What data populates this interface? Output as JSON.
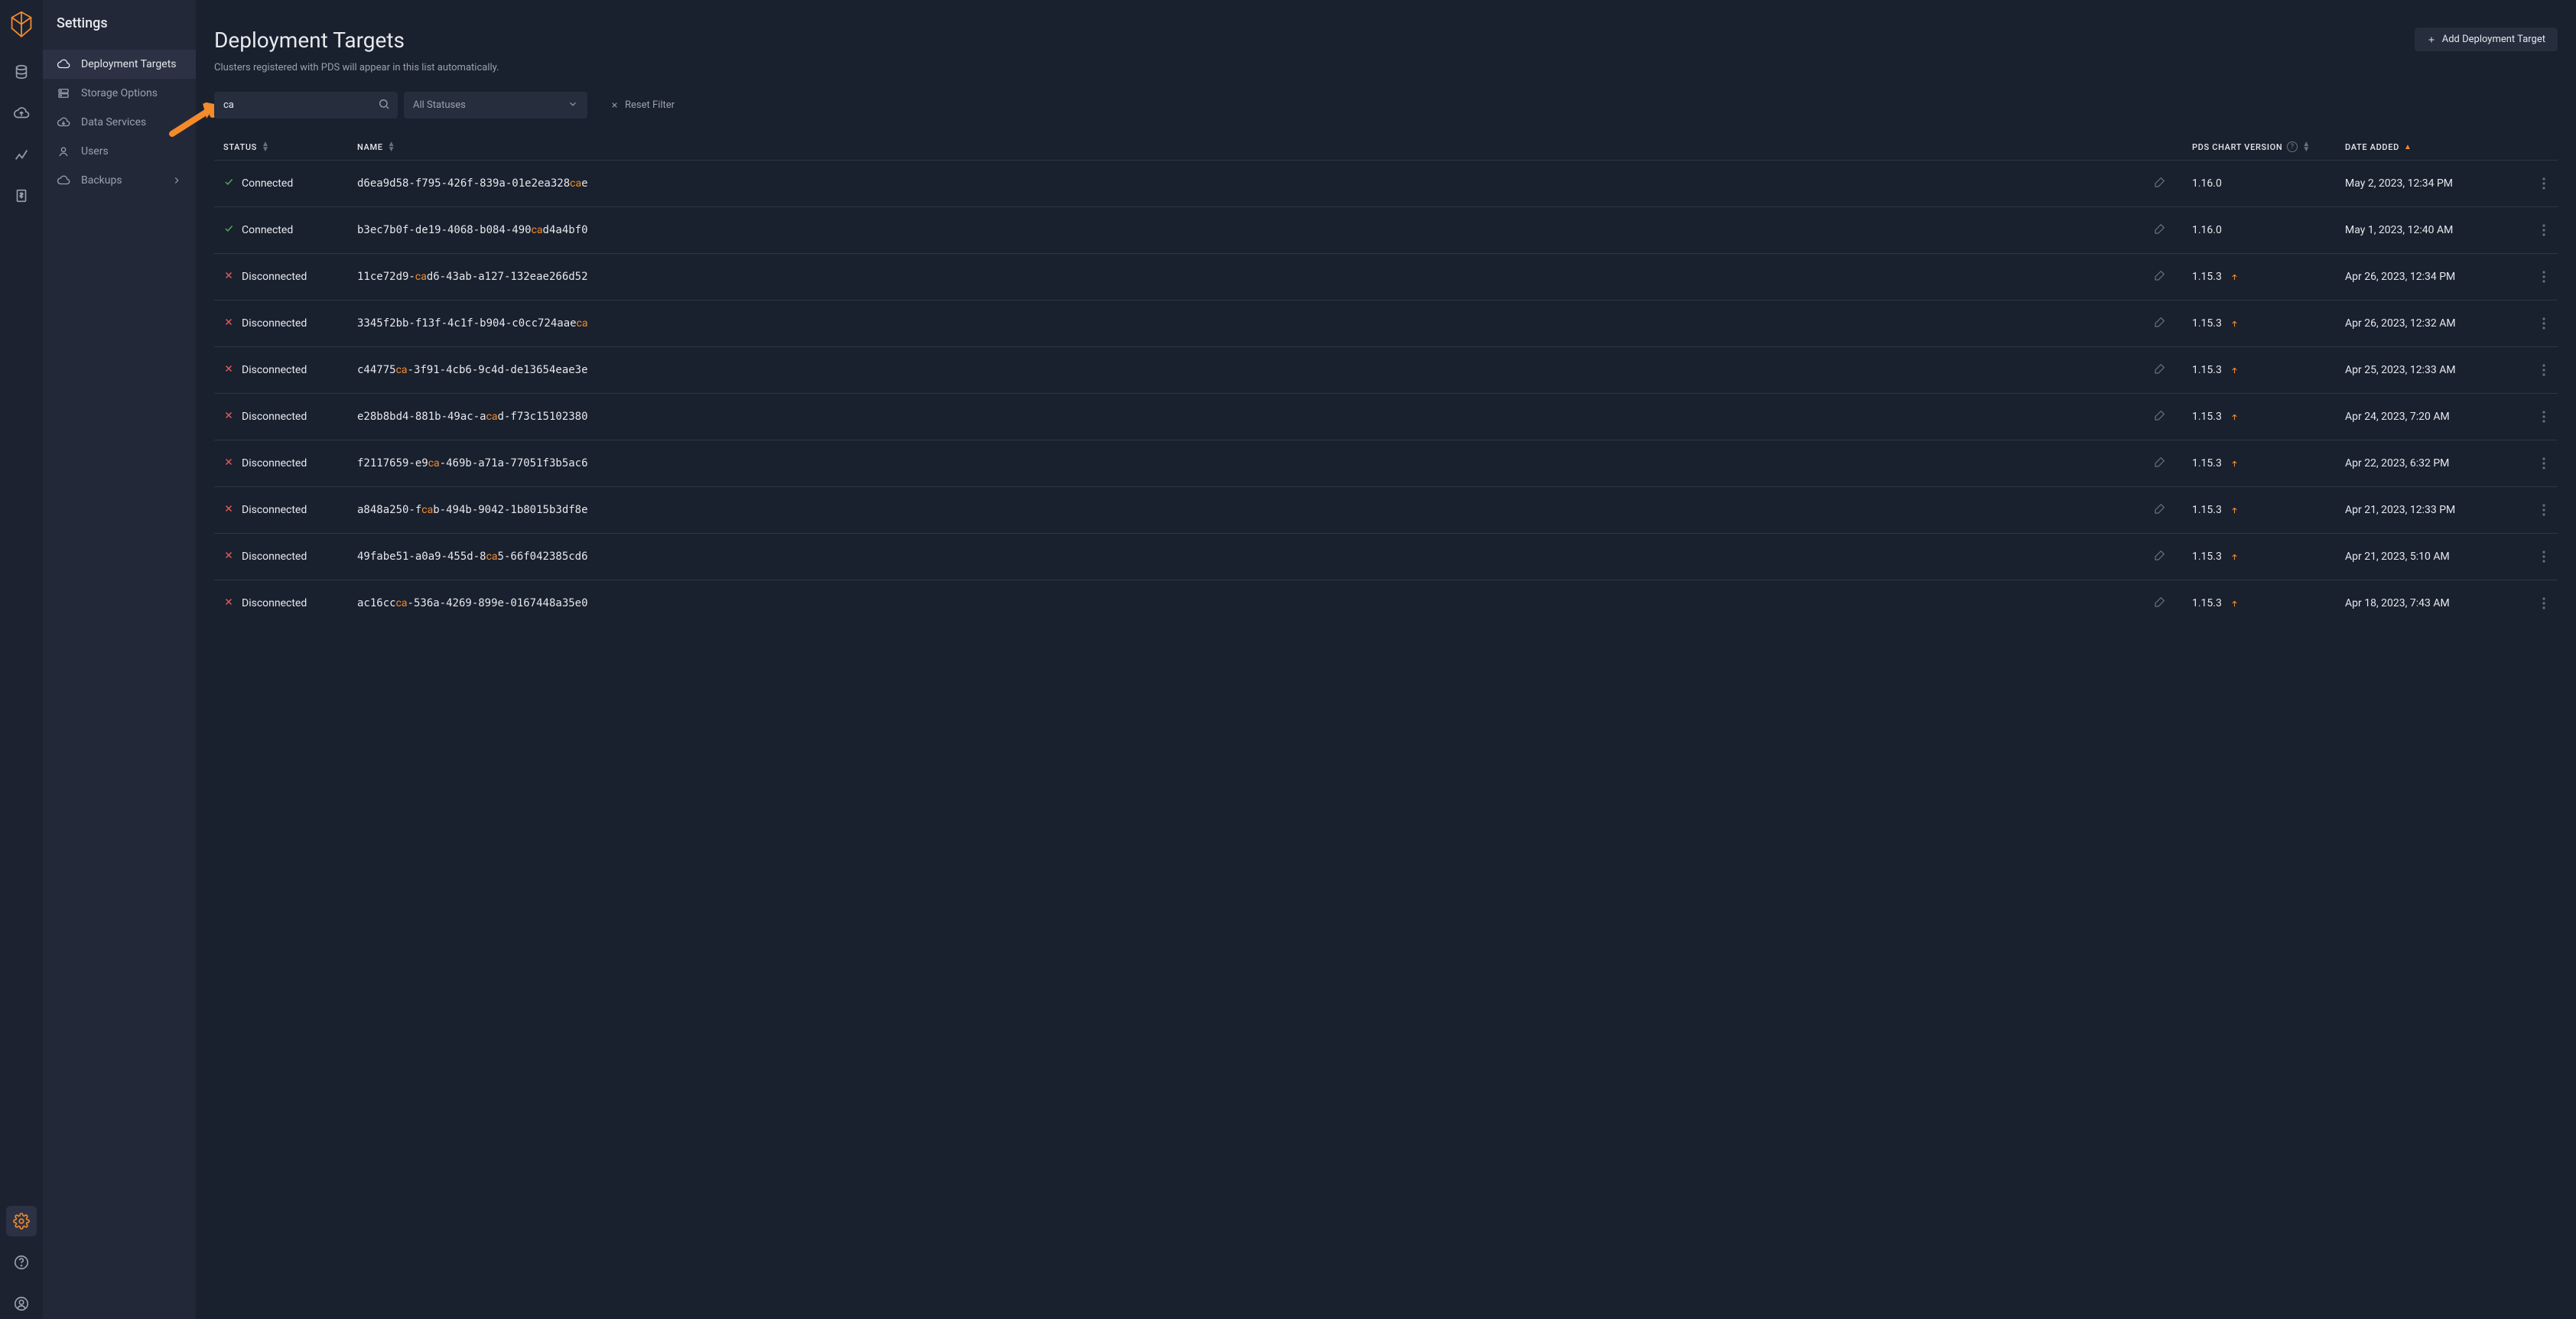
{
  "sidebar": {
    "title": "Settings",
    "items": [
      {
        "label": "Deployment Targets"
      },
      {
        "label": "Storage Options"
      },
      {
        "label": "Data Services"
      },
      {
        "label": "Users"
      },
      {
        "label": "Backups"
      }
    ]
  },
  "page": {
    "title": "Deployment Targets",
    "subtitle": "Clusters registered with PDS will appear in this list automatically.",
    "add_button": "Add Deployment Target"
  },
  "filter": {
    "search_value": "ca",
    "status_selected": "All Statuses",
    "reset_label": "Reset Filter"
  },
  "columns": {
    "status": "Status",
    "name": "Name",
    "version": "PDS Chart Version",
    "date": "Date Added"
  },
  "rows": [
    {
      "status": "Connected",
      "name_pre": "d6ea9d58-f795-426f-839a-01e2ea328",
      "name_hl": "ca",
      "name_post": "e",
      "version": "1.16.0",
      "upgrade": false,
      "date": "May 2, 2023, 12:34 PM"
    },
    {
      "status": "Connected",
      "name_pre": "b3ec7b0f-de19-4068-b084-490",
      "name_hl": "ca",
      "name_post": "d4a4bf0",
      "version": "1.16.0",
      "upgrade": false,
      "date": "May 1, 2023, 12:40 AM"
    },
    {
      "status": "Disconnected",
      "name_pre": "11ce72d9-",
      "name_hl": "ca",
      "name_post": "d6-43ab-a127-132eae266d52",
      "version": "1.15.3",
      "upgrade": true,
      "date": "Apr 26, 2023, 12:34 PM"
    },
    {
      "status": "Disconnected",
      "name_pre": "3345f2bb-f13f-4c1f-b904-c0cc724aae",
      "name_hl": "ca",
      "name_post": "",
      "version": "1.15.3",
      "upgrade": true,
      "date": "Apr 26, 2023, 12:32 AM"
    },
    {
      "status": "Disconnected",
      "name_pre": "c44775",
      "name_hl": "ca",
      "name_post": "-3f91-4cb6-9c4d-de13654eae3e",
      "version": "1.15.3",
      "upgrade": true,
      "date": "Apr 25, 2023, 12:33 AM"
    },
    {
      "status": "Disconnected",
      "name_pre": "e28b8bd4-881b-49ac-a",
      "name_hl": "ca",
      "name_post": "d-f73c15102380",
      "version": "1.15.3",
      "upgrade": true,
      "date": "Apr 24, 2023, 7:20 AM"
    },
    {
      "status": "Disconnected",
      "name_pre": "f2117659-e9",
      "name_hl": "ca",
      "name_post": "-469b-a71a-77051f3b5ac6",
      "version": "1.15.3",
      "upgrade": true,
      "date": "Apr 22, 2023, 6:32 PM"
    },
    {
      "status": "Disconnected",
      "name_pre": "a848a250-f",
      "name_hl": "ca",
      "name_post": "b-494b-9042-1b8015b3df8e",
      "version": "1.15.3",
      "upgrade": true,
      "date": "Apr 21, 2023, 12:33 PM"
    },
    {
      "status": "Disconnected",
      "name_pre": "49fabe51-a0a9-455d-8",
      "name_hl": "ca",
      "name_post": "5-66f042385cd6",
      "version": "1.15.3",
      "upgrade": true,
      "date": "Apr 21, 2023, 5:10 AM"
    },
    {
      "status": "Disconnected",
      "name_pre": "ac16cc",
      "name_hl": "ca",
      "name_post": "-536a-4269-899e-0167448a35e0",
      "version": "1.15.3",
      "upgrade": true,
      "date": "Apr 18, 2023, 7:43 AM"
    }
  ]
}
